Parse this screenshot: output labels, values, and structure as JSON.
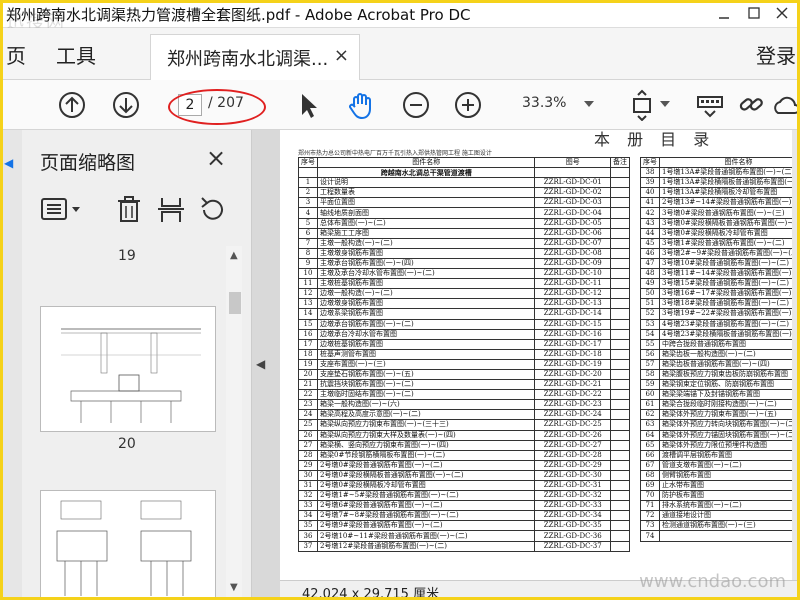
{
  "window": {
    "title": "郑州跨南水北调渠热力管渡槽全套图纸.pdf - Adobe Acrobat Pro DC",
    "watermark": "迅搜网"
  },
  "menu": {
    "page_label": "页",
    "tools_label": "工具",
    "login_label": "登录"
  },
  "tab": {
    "label": "郑州跨南水北调渠...",
    "close": "×"
  },
  "toolbar": {
    "current_page": "2",
    "total_pages": "/ 207",
    "zoom": "33.3%"
  },
  "sidebar": {
    "title": "页面缩略图",
    "close": "×",
    "thumbnails": [
      {
        "label": "19"
      },
      {
        "label": "20"
      }
    ]
  },
  "document": {
    "big_title": "本 册 目 录",
    "header_left": "郑州市热力总公司新中热电厂百万千瓦引热入郑供热管网工程     施工图设计",
    "left_table": {
      "headers": [
        "序号",
        "图件名称",
        "图号",
        "备注"
      ],
      "section_title": "跨越南水北调总干渠管道渡槽",
      "rows": [
        [
          "1",
          "设计说明",
          "ZZRL-GD-DC-01"
        ],
        [
          "2",
          "工程数量表",
          "ZZRL-GD-DC-02"
        ],
        [
          "3",
          "平面位置图",
          "ZZRL-GD-DC-03"
        ],
        [
          "4",
          "轴线地质剖面图",
          "ZZRL-GD-DC-04"
        ],
        [
          "5",
          "总体布置图(一)~(二)",
          "ZZRL-GD-DC-05"
        ],
        [
          "6",
          "箱梁施工工序图",
          "ZZRL-GD-DC-06"
        ],
        [
          "7",
          "主墩一般构造(一)~(二)",
          "ZZRL-GD-DC-07"
        ],
        [
          "8",
          "主墩墩身钢筋布置图",
          "ZZRL-GD-DC-08"
        ],
        [
          "9",
          "主墩承台钢筋布置图(一)~(四)",
          "ZZRL-GD-DC-09"
        ],
        [
          "10",
          "主墩及承台冷却水管布置图(一)~(二)",
          "ZZRL-GD-DC-10"
        ],
        [
          "11",
          "主墩桩基钢筋布置图",
          "ZZRL-GD-DC-11"
        ],
        [
          "12",
          "边墩一般构造(一)~(二)",
          "ZZRL-GD-DC-12"
        ],
        [
          "13",
          "边墩墩身钢筋布置图",
          "ZZRL-GD-DC-13"
        ],
        [
          "14",
          "边墩系梁钢筋布置图",
          "ZZRL-GD-DC-14"
        ],
        [
          "15",
          "边墩承台钢筋布置图(一)~(二)",
          "ZZRL-GD-DC-15"
        ],
        [
          "16",
          "边墩承台冷却水管布置图",
          "ZZRL-GD-DC-16"
        ],
        [
          "17",
          "边墩桩基钢筋布置图",
          "ZZRL-GD-DC-17"
        ],
        [
          "18",
          "桩基声测管布置图",
          "ZZRL-GD-DC-18"
        ],
        [
          "19",
          "支座布置图(一)~(三)",
          "ZZRL-GD-DC-19"
        ],
        [
          "20",
          "支座垫石钢筋布置图(一)~(五)",
          "ZZRL-GD-DC-20"
        ],
        [
          "21",
          "抗震挡块钢筋布置图(一)~(二)",
          "ZZRL-GD-DC-21"
        ],
        [
          "22",
          "主墩临时固结布置图(一)~(二)",
          "ZZRL-GD-DC-22"
        ],
        [
          "23",
          "箱梁一般构造图(一)~(六)",
          "ZZRL-GD-DC-23"
        ],
        [
          "24",
          "箱梁高程及高度示意图(一)~(二)",
          "ZZRL-GD-DC-24"
        ],
        [
          "25",
          "箱梁纵向预应力钢束布置图(一)~(三十三)",
          "ZZRL-GD-DC-25"
        ],
        [
          "26",
          "箱梁纵向预应力钢束大样及数量表(一)~(四)",
          "ZZRL-GD-DC-26"
        ],
        [
          "27",
          "箱梁横、竖向预应力钢束布置图(一)~(四)",
          "ZZRL-GD-DC-27"
        ],
        [
          "28",
          "箱梁0#节段钢筋横隔板布置图(一)~(二)",
          "ZZRL-GD-DC-28"
        ],
        [
          "29",
          "2号墩0#梁段普通钢筋布置图(一)~(二)",
          "ZZRL-GD-DC-29"
        ],
        [
          "30",
          "2号墩0#梁段横隔板普通钢筋布置图(一)~(二)",
          "ZZRL-GD-DC-30"
        ],
        [
          "31",
          "2号墩0#梁段横隔板冷却管布置图",
          "ZZRL-GD-DC-31"
        ],
        [
          "32",
          "2号墩1#~5#梁段普通钢筋布置图(一)~(二)",
          "ZZRL-GD-DC-32"
        ],
        [
          "33",
          "2号墩6#梁段普通钢筋布置图(一)~(二)",
          "ZZRL-GD-DC-33"
        ],
        [
          "34",
          "2号墩7#~8#梁段普通钢筋布置图(一)~(二)",
          "ZZRL-GD-DC-34"
        ],
        [
          "35",
          "2号墩9#梁段普通钢筋布置图(一)~(二)",
          "ZZRL-GD-DC-35"
        ],
        [
          "36",
          "2号墩10#~11#梁段普通钢筋布置图(一)~(二)",
          "ZZRL-GD-DC-36"
        ],
        [
          "37",
          "2号墩12#梁段普通钢筋布置图(一)~(二)",
          "ZZRL-GD-DC-37"
        ]
      ]
    },
    "right_table": {
      "headers": [
        "序号",
        "图件名称"
      ],
      "rows": [
        [
          "38",
          "1号墩13A#梁段普通钢筋布置图(一)~(二)"
        ],
        [
          "39",
          "1号墩13A#梁段横隔板普通钢筋布置图(一)~(二)"
        ],
        [
          "40",
          "1号墩13A#梁段横隔板冷却管布置图"
        ],
        [
          "41",
          "2号墩13#~14#梁段普通钢筋布置图(一)~(二)"
        ],
        [
          "42",
          "3号墩0#梁段普通钢筋布置图(一)~(三)"
        ],
        [
          "43",
          "3号墩0#梁段横隔板普通钢筋布置图(一)~(二)"
        ],
        [
          "44",
          "3号墩0#梁段横隔板冷却管布置图"
        ],
        [
          "45",
          "3号墩1#梁段普通钢筋布置图(一)~(二)"
        ],
        [
          "46",
          "3号墩2#~9#梁段普通钢筋布置图(一)~(二)"
        ],
        [
          "47",
          "3号墩10#梁段普通钢筋布置图(一)~(二)"
        ],
        [
          "48",
          "3号墩11#~14#梁段普通钢筋布置图(一)~(二)"
        ],
        [
          "49",
          "3号墩15#梁段普通钢筋布置图(一)~(二)"
        ],
        [
          "50",
          "3号墩16#~17#梁段普通钢筋布置图(一)~(二)"
        ],
        [
          "51",
          "3号墩18#梁段普通钢筋布置图(一)~(二)"
        ],
        [
          "52",
          "3号墩19#~22#梁段普通钢筋布置图(一)~(二)"
        ],
        [
          "53",
          "4号墩23#梁段普通钢筋布置图(一)~(二)"
        ],
        [
          "54",
          "4号墩23#梁段横隔板普通钢筋布置图(一)~(二)"
        ],
        [
          "55",
          "中跨合拢段普通钢筋布置图"
        ],
        [
          "56",
          "箱梁齿板一般构造图(一)~(二)"
        ],
        [
          "57",
          "箱梁齿板普通钢筋布置图(一)~(四)"
        ],
        [
          "58",
          "箱梁腹板预应力钢束齿板防崩钢筋布置图"
        ],
        [
          "59",
          "箱梁钢束定位钢筋、防崩钢筋布置图"
        ],
        [
          "60",
          "箱梁梁端锚下及封锚钢筋布置图"
        ],
        [
          "61",
          "箱梁合拢段临时刚接构造图(一)~(二)"
        ],
        [
          "62",
          "箱梁体外预应力钢束布置图(一)~(五)"
        ],
        [
          "63",
          "箱梁体外预应力转向块钢筋布置图(一)~(二)"
        ],
        [
          "64",
          "箱梁体外预应力锚固块钢筋布置图(一)~(二)"
        ],
        [
          "65",
          "箱梁体外预应力限位预埋件构造图"
        ],
        [
          "66",
          "渡槽调平层钢筋布置图"
        ],
        [
          "67",
          "管道支墩布置图(一)~(二)"
        ],
        [
          "68",
          "侧臂钢筋布置图"
        ],
        [
          "69",
          "止水带布置图"
        ],
        [
          "70",
          "防护板布置图"
        ],
        [
          "71",
          "排水系统布置图(一)~(二)"
        ],
        [
          "72",
          "通道接地设计图"
        ],
        [
          "73",
          "检测通道钢筋布置图(一)~(三)"
        ],
        [
          "74",
          ""
        ]
      ]
    }
  },
  "status": {
    "dimensions": "42.024 x 29.715 厘米",
    "watermark": "www.cndao.com"
  }
}
